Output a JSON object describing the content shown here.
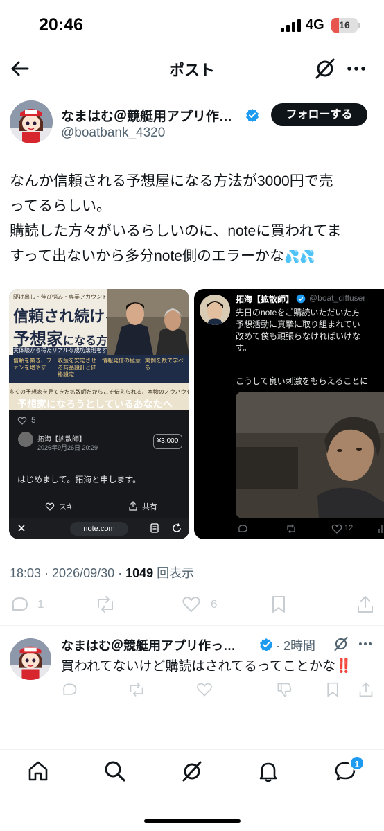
{
  "status_bar": {
    "time": "20:46",
    "network": "4G",
    "battery": "16"
  },
  "header": {
    "title": "ポスト"
  },
  "author": {
    "name": "なまはむ＠競艇用アプリ作…",
    "handle": "@boatbank_4320",
    "follow_label": "フォローする"
  },
  "post": {
    "lines": [
      "なんか信頼される予想屋になる方法が3000円で売",
      "ってるらしい。",
      "購読した方々がいるらしいのに、noteに買われてま",
      "すって出ないから多分note側のエラーかな"
    ],
    "emoji": "💦💦"
  },
  "media_left": {
    "banner_small": "駆け出し・伸び悩み・専業アカウントの方へ",
    "banner_title1": "信頼され続ける",
    "banner_title2a": "予想家",
    "banner_title2b": "になる方法",
    "banner_sub": "実体験から得たリアルな成功法則をすべて公開",
    "strip": [
      "信頼を築き、ファンを増やす",
      "収益を安定させる商品設計と価格設定",
      "情報発信の極意",
      "実例を数で学べる"
    ],
    "banner_footer": "多くの予想家を見てきた拡散師だからこそ伝えられる、本物のノウハウをあなたへ。",
    "note_title": "予想家になろうとしているあなたへ",
    "like_count": "5",
    "note_author": "拓海【拡散師】",
    "note_date": "2026年9月26日 20:29",
    "price": "¥3,000",
    "intro": "はじめまして。拓海と申します。",
    "like_label": "スキ",
    "share_label": "共有",
    "url": "note.com"
  },
  "media_right": {
    "name": "拓海【拡散師】",
    "handle": "@boat_diffuser",
    "text_lines": [
      "先日のnoteをご購読いただいた方",
      "予想活動に真摯に取り組まれてい",
      "改めて僕も頑張らなければいけな",
      "す。"
    ],
    "text2": "こうして良い刺激をもらえることに",
    "like_count": "12"
  },
  "meta": {
    "time": "18:03 · 2026/09/30 · ",
    "views": "1049",
    "views_label": " 回表示"
  },
  "actions": {
    "replies": "1",
    "likes": "6"
  },
  "reply": {
    "name": "なまはむ＠競艇用アプリ作っ…",
    "time": "· 2時間",
    "text": "買われてないけど購読はされてるってことかな‼️"
  },
  "tabbar": {
    "messages_badge": "1"
  },
  "colors": {
    "accent": "#1d9bf0",
    "follow_bg": "#0f1419",
    "muted": "#536471"
  },
  "icons": [
    "back-arrow-icon",
    "grok-icon",
    "more-icon",
    "reply-icon",
    "repost-icon",
    "heart-icon",
    "bookmark-icon",
    "share-icon",
    "home-icon",
    "search-icon",
    "bell-icon",
    "messages-icon"
  ]
}
